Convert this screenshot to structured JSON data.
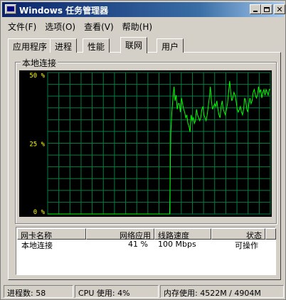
{
  "window": {
    "title": "Windows 任务管理器"
  },
  "menu": [
    "文件(F)",
    "选项(O)",
    "查看(V)",
    "帮助(H)"
  ],
  "tabs": [
    {
      "label": "应用程序",
      "active": false
    },
    {
      "label": "进程",
      "active": false
    },
    {
      "label": "性能",
      "active": false
    },
    {
      "label": "联网",
      "active": true
    },
    {
      "label": "用户",
      "active": false
    }
  ],
  "network": {
    "group_title": "本地连接",
    "graph": {
      "y_labels": [
        "50 %",
        "25 %",
        "0 %"
      ],
      "line_color": "#00ff00",
      "grid_color": "#008040",
      "values": [
        0,
        0,
        0,
        0,
        0,
        0,
        0,
        0,
        0,
        0,
        0,
        0,
        0,
        0,
        0,
        0,
        0,
        0,
        0,
        0,
        0,
        0,
        0,
        0,
        0,
        0,
        0,
        0,
        0,
        0,
        0,
        0,
        0,
        0,
        0,
        0,
        0,
        0,
        0,
        0,
        0,
        0,
        0,
        0,
        0,
        0,
        0,
        0,
        0,
        0,
        0,
        0,
        0,
        0,
        0,
        0,
        0,
        0,
        0,
        0,
        0,
        0,
        0,
        0,
        0,
        0,
        0,
        0,
        0,
        0,
        0,
        0,
        0,
        0,
        0,
        0,
        0,
        0,
        0,
        0,
        0,
        0,
        0,
        0,
        0,
        0,
        0,
        0,
        0,
        0,
        0,
        0,
        0,
        0,
        0,
        0,
        0,
        0,
        0,
        0,
        0,
        0,
        0,
        0,
        0,
        0,
        0,
        0,
        0,
        0,
        0,
        0,
        0,
        0,
        0,
        29,
        36,
        41,
        45,
        40,
        42,
        37,
        39,
        39,
        36,
        41,
        39,
        37,
        36,
        34,
        35,
        32,
        31,
        29,
        35,
        33,
        34,
        32,
        33,
        37,
        35,
        34,
        33,
        34,
        37,
        38,
        35,
        34,
        33,
        35,
        38,
        41,
        45,
        40,
        37,
        38,
        39,
        38,
        40,
        37,
        35,
        34,
        38,
        40,
        37,
        36,
        35,
        37,
        39,
        43,
        47,
        43,
        40,
        41,
        43,
        42,
        40,
        37,
        36,
        37,
        38,
        36,
        35,
        37,
        41,
        40,
        37,
        36,
        39,
        41,
        39,
        40,
        43,
        44,
        42,
        41,
        42,
        45,
        43,
        44,
        41,
        43,
        44,
        42,
        44,
        43,
        42,
        44,
        44
      ]
    },
    "list": {
      "headers": [
        "网卡名称",
        "网络应用",
        "线路速度",
        "状态"
      ],
      "rows": [
        {
          "name": "本地连接",
          "usage": "41 %",
          "speed": "100 Mbps",
          "status": "可操作"
        }
      ]
    }
  },
  "status": {
    "processes": "进程数: 58",
    "cpu": "CPU 使用: 4%",
    "memory": "内存使用: 4522M / 4904M"
  }
}
